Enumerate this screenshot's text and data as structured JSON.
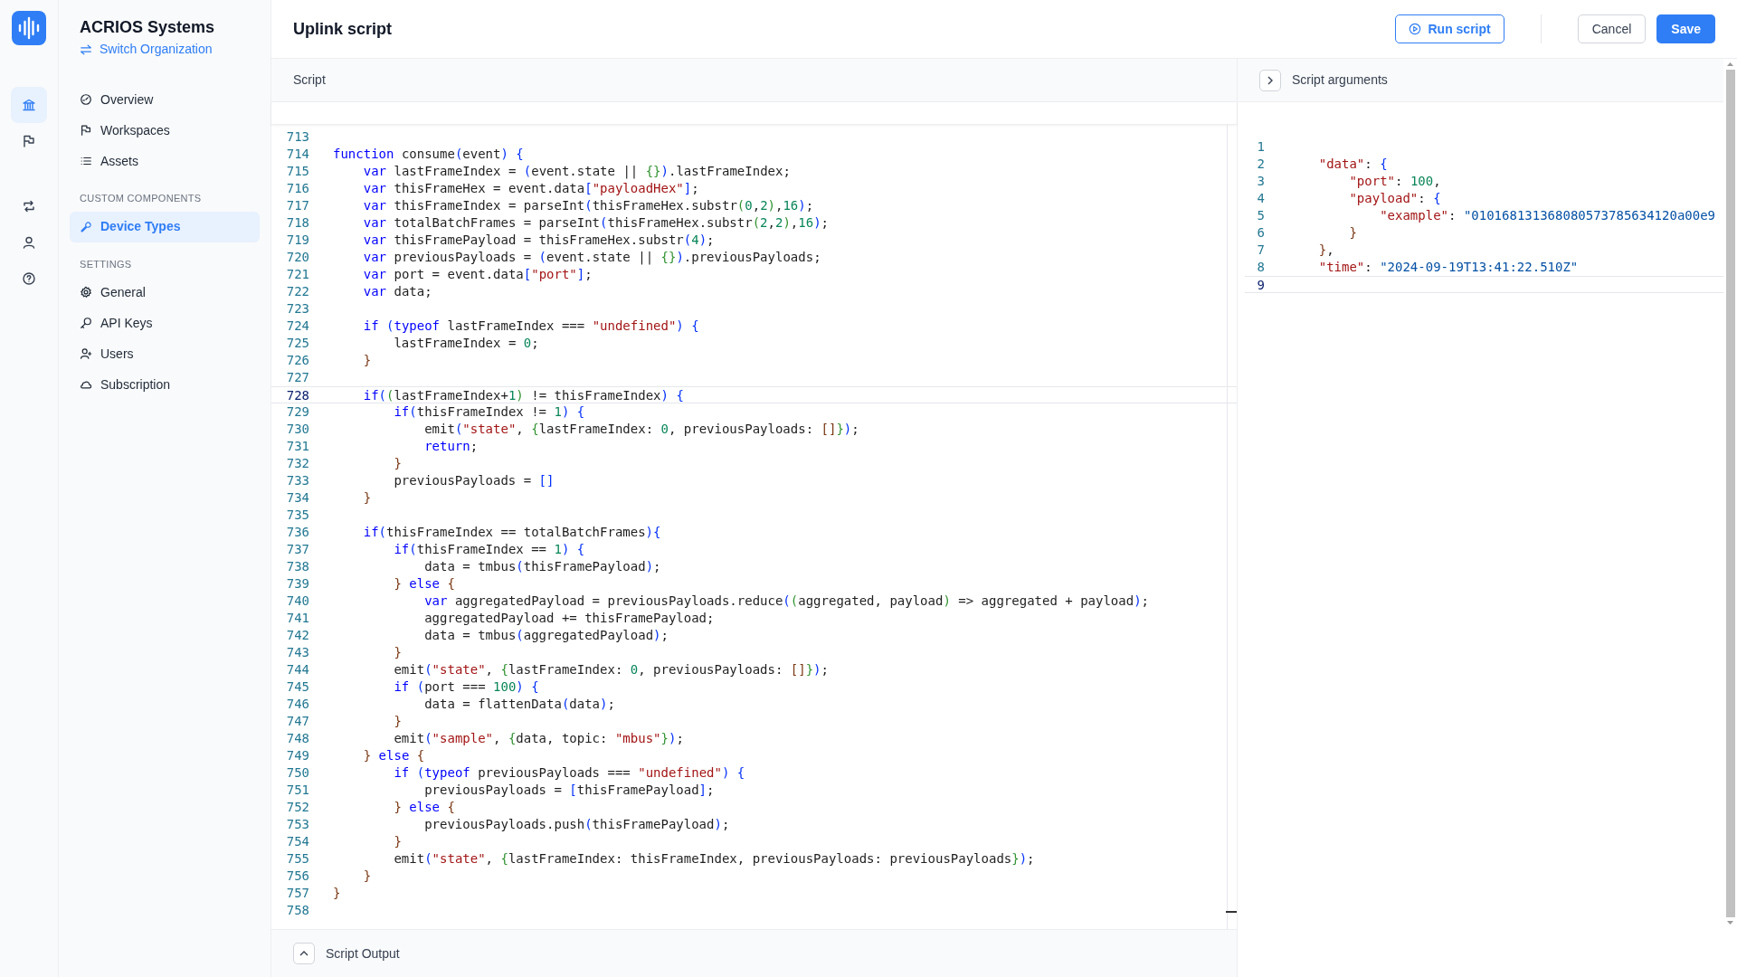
{
  "organization": {
    "name": "ACRIOS Systems",
    "switch_link": "Switch Organization"
  },
  "rail": [
    {
      "selected": true
    },
    {
      "selected": false
    },
    {
      "selected": false
    },
    {
      "selected": false
    },
    {
      "selected": false
    }
  ],
  "sidebar": {
    "sections": [
      {
        "items": [
          {
            "label": "Overview",
            "selected": false
          },
          {
            "label": "Workspaces",
            "selected": false
          },
          {
            "label": "Assets",
            "selected": false
          }
        ]
      },
      {
        "heading": "CUSTOM COMPONENTS",
        "items": [
          {
            "label": "Device Types",
            "selected": true
          }
        ]
      },
      {
        "heading": "SETTINGS",
        "items": [
          {
            "label": "General",
            "selected": false
          },
          {
            "label": "API Keys",
            "selected": false
          },
          {
            "label": "Users",
            "selected": false
          },
          {
            "label": "Subscription",
            "selected": false
          }
        ]
      }
    ]
  },
  "header": {
    "title": "Uplink script",
    "buttons": [
      {
        "label": "Run script",
        "kind": "outline"
      },
      {
        "label": "Cancel",
        "kind": "plain"
      },
      {
        "label": "Save",
        "kind": "primary"
      }
    ]
  },
  "script_panel": {
    "title": "Script",
    "lines": [
      {
        "n": "713",
        "active": false
      },
      {
        "n": "714",
        "text": "function consume(event) {",
        "active": false
      },
      {
        "n": "715",
        "text": "    var lastFrameIndex = (event.state || {}).lastFrameIndex;",
        "active": false
      },
      {
        "n": "716",
        "text": "    var thisFrameHex = event.data[\"payloadHex\"];",
        "active": false
      },
      {
        "n": "717",
        "text": "    var thisFrameIndex = parseInt(thisFrameHex.substr(0,2),16);",
        "active": false
      },
      {
        "n": "718",
        "text": "    var totalBatchFrames = parseInt(thisFrameHex.substr(2,2),16);",
        "active": false
      },
      {
        "n": "719",
        "text": "    var thisFramePayload = thisFrameHex.substr(4);",
        "active": false
      },
      {
        "n": "720",
        "text": "    var previousPayloads = (event.state || {}).previousPayloads;",
        "active": false
      },
      {
        "n": "721",
        "text": "    var port = event.data[\"port\"];",
        "active": false
      },
      {
        "n": "722",
        "text": "    var data;",
        "active": false
      },
      {
        "n": "723",
        "active": false
      },
      {
        "n": "724",
        "text": "    if (typeof lastFrameIndex === \"undefined\") {",
        "active": false
      },
      {
        "n": "725",
        "text": "        lastFrameIndex = 0;",
        "active": false
      },
      {
        "n": "726",
        "text": "    }",
        "active": false
      },
      {
        "n": "727",
        "active": false
      },
      {
        "n": "728",
        "text": "    if((lastFrameIndex+1) != thisFrameIndex) {",
        "active": true
      },
      {
        "n": "729",
        "text": "        if(thisFrameIndex != 1) {",
        "active": false
      },
      {
        "n": "730",
        "text": "            emit(\"state\", {lastFrameIndex: 0, previousPayloads: []});",
        "active": false
      },
      {
        "n": "731",
        "text": "            return;",
        "active": false
      },
      {
        "n": "732",
        "text": "        }",
        "active": false
      },
      {
        "n": "733",
        "text": "        previousPayloads = []",
        "active": false
      },
      {
        "n": "734",
        "text": "    }",
        "active": false
      },
      {
        "n": "735",
        "active": false
      },
      {
        "n": "736",
        "text": "    if(thisFrameIndex == totalBatchFrames){",
        "active": false
      },
      {
        "n": "737",
        "text": "        if(thisFrameIndex == 1) {",
        "active": false
      },
      {
        "n": "738",
        "text": "            data = tmbus(thisFramePayload);",
        "active": false
      },
      {
        "n": "739",
        "text": "        } else {",
        "active": false
      },
      {
        "n": "740",
        "text": "            var aggregatedPayload = previousPayloads.reduce((aggregated, payload) => aggregated + payload);",
        "active": false
      },
      {
        "n": "741",
        "text": "            aggregatedPayload += thisFramePayload;",
        "active": false
      },
      {
        "n": "742",
        "text": "            data = tmbus(aggregatedPayload);",
        "active": false
      },
      {
        "n": "743",
        "text": "        }",
        "active": false
      },
      {
        "n": "744",
        "text": "        emit(\"state\", {lastFrameIndex: 0, previousPayloads: []});",
        "active": false
      },
      {
        "n": "745",
        "text": "        if (port === 100) {",
        "active": false
      },
      {
        "n": "746",
        "text": "            data = flattenData(data);",
        "active": false
      },
      {
        "n": "747",
        "text": "        }",
        "active": false
      },
      {
        "n": "748",
        "text": "        emit(\"sample\", {data, topic: \"mbus\"});",
        "active": false
      },
      {
        "n": "749",
        "text": "    } else {",
        "active": false
      },
      {
        "n": "750",
        "text": "        if (typeof previousPayloads === \"undefined\") {",
        "active": false
      },
      {
        "n": "751",
        "text": "            previousPayloads = [thisFramePayload];",
        "active": false
      },
      {
        "n": "752",
        "text": "        } else {",
        "active": false
      },
      {
        "n": "753",
        "text": "            previousPayloads.push(thisFramePayload);",
        "active": false
      },
      {
        "n": "754",
        "text": "        }",
        "active": false
      },
      {
        "n": "755",
        "text": "        emit(\"state\", {lastFrameIndex: thisFrameIndex, previousPayloads: previousPayloads});",
        "active": false
      },
      {
        "n": "756",
        "text": "    }",
        "active": false
      },
      {
        "n": "757",
        "text": "}",
        "active": false
      },
      {
        "n": "758",
        "active": false
      }
    ]
  },
  "arguments_panel": {
    "title": "Script arguments",
    "lines": [
      {
        "n": "1",
        "active": false
      },
      {
        "n": "2",
        "text": "    \"data\": {",
        "active": false
      },
      {
        "n": "3",
        "text": "        \"port\": 100,",
        "active": false
      },
      {
        "n": "4",
        "text": "        \"payload\": {",
        "active": false
      },
      {
        "n": "5",
        "text": "            \"example\": \"010168131368080573785634120a00e9",
        "active": false
      },
      {
        "n": "6",
        "text": "        }",
        "active": false
      },
      {
        "n": "7",
        "text": "    },",
        "active": false
      },
      {
        "n": "8",
        "text": "    \"time\": \"2024-09-19T13:41:22.510Z\"",
        "active": false
      },
      {
        "n": "9",
        "active": true
      }
    ]
  },
  "output_panel": {
    "title": "Script Output"
  }
}
